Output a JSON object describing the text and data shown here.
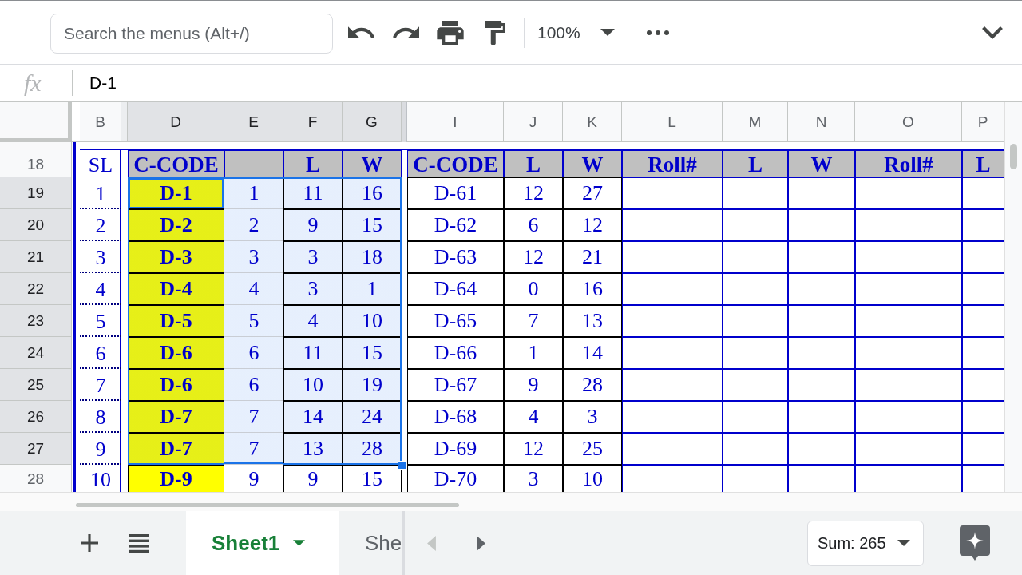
{
  "toolbar": {
    "search": {
      "placeholder": "Search the menus (Alt+/)"
    },
    "zoom": "100%"
  },
  "formula_bar": {
    "label": "fx",
    "value": "D-1"
  },
  "columns": [
    {
      "label": "B",
      "selected": false
    },
    {
      "label": "D",
      "selected": true
    },
    {
      "label": "E",
      "selected": true
    },
    {
      "label": "F",
      "selected": true
    },
    {
      "label": "G",
      "selected": true
    },
    {
      "label": "I",
      "selected": false
    },
    {
      "label": "J",
      "selected": false
    },
    {
      "label": "K",
      "selected": false
    },
    {
      "label": "L",
      "selected": false
    },
    {
      "label": "M",
      "selected": false
    },
    {
      "label": "N",
      "selected": false
    },
    {
      "label": "O",
      "selected": false
    },
    {
      "label": "P",
      "selected": false
    }
  ],
  "rows": [
    {
      "number": "18",
      "selected": false,
      "cells": [
        {
          "text": "SL",
          "kind": "serial",
          "selected": false,
          "active": false
        },
        {
          "text": "C-CODE",
          "kind": "header",
          "selected": false,
          "active": false
        },
        {
          "kind": "header",
          "selected": false,
          "active": false
        },
        {
          "text": "L",
          "kind": "header",
          "selected": false,
          "active": false
        },
        {
          "text": "W",
          "kind": "header",
          "selected": false,
          "active": false
        },
        {
          "text": "C-CODE",
          "kind": "header",
          "selected": false,
          "active": false
        },
        {
          "text": "L",
          "kind": "header",
          "selected": false,
          "active": false
        },
        {
          "text": "W",
          "kind": "header",
          "selected": false,
          "active": false
        },
        {
          "text": "Roll#",
          "kind": "header",
          "selected": false,
          "active": false
        },
        {
          "text": "L",
          "kind": "header",
          "selected": false,
          "active": false
        },
        {
          "text": "W",
          "kind": "header",
          "selected": false,
          "active": false
        },
        {
          "text": "Roll#",
          "kind": "header",
          "selected": false,
          "active": false
        },
        {
          "text": "L",
          "kind": "header",
          "selected": false,
          "active": false
        }
      ]
    },
    {
      "number": "19",
      "selected": true,
      "cells": [
        {
          "text": "1",
          "kind": "serial",
          "selected": false,
          "active": false
        },
        {
          "text": "D-1",
          "kind": "code",
          "selected": true,
          "active": true
        },
        {
          "text": "1",
          "kind": "bare",
          "selected": true,
          "active": false
        },
        {
          "text": "11",
          "kind": "plain",
          "selected": true,
          "active": false
        },
        {
          "text": "16",
          "kind": "plain",
          "selected": true,
          "active": false
        },
        {
          "text": "D-61",
          "kind": "plain",
          "selected": false,
          "active": false
        },
        {
          "text": "12",
          "kind": "plain",
          "selected": false,
          "active": false
        },
        {
          "text": "27",
          "kind": "plain",
          "selected": false,
          "active": false
        }
      ]
    },
    {
      "number": "20",
      "selected": true,
      "cells": [
        {
          "text": "2",
          "kind": "serial",
          "selected": false,
          "active": false
        },
        {
          "text": "D-2",
          "kind": "code",
          "selected": true,
          "active": false
        },
        {
          "text": "2",
          "kind": "bare",
          "selected": true,
          "active": false
        },
        {
          "text": "9",
          "kind": "plain",
          "selected": true,
          "active": false
        },
        {
          "text": "15",
          "kind": "plain",
          "selected": true,
          "active": false
        },
        {
          "text": "D-62",
          "kind": "plain",
          "selected": false,
          "active": false
        },
        {
          "text": "6",
          "kind": "plain",
          "selected": false,
          "active": false
        },
        {
          "text": "12",
          "kind": "plain",
          "selected": false,
          "active": false
        }
      ]
    },
    {
      "number": "21",
      "selected": true,
      "cells": [
        {
          "text": "3",
          "kind": "serial",
          "selected": false,
          "active": false
        },
        {
          "text": "D-3",
          "kind": "code",
          "selected": true,
          "active": false
        },
        {
          "text": "3",
          "kind": "bare",
          "selected": true,
          "active": false
        },
        {
          "text": "3",
          "kind": "plain",
          "selected": true,
          "active": false
        },
        {
          "text": "18",
          "kind": "plain",
          "selected": true,
          "active": false
        },
        {
          "text": "D-63",
          "kind": "plain",
          "selected": false,
          "active": false
        },
        {
          "text": "12",
          "kind": "plain",
          "selected": false,
          "active": false
        },
        {
          "text": "21",
          "kind": "plain",
          "selected": false,
          "active": false
        }
      ]
    },
    {
      "number": "22",
      "selected": true,
      "cells": [
        {
          "text": "4",
          "kind": "serial",
          "selected": false,
          "active": false
        },
        {
          "text": "D-4",
          "kind": "code",
          "selected": true,
          "active": false
        },
        {
          "text": "4",
          "kind": "bare",
          "selected": true,
          "active": false
        },
        {
          "text": "3",
          "kind": "plain",
          "selected": true,
          "active": false
        },
        {
          "text": "1",
          "kind": "plain",
          "selected": true,
          "active": false
        },
        {
          "text": "D-64",
          "kind": "plain",
          "selected": false,
          "active": false
        },
        {
          "text": "0",
          "kind": "plain",
          "selected": false,
          "active": false
        },
        {
          "text": "16",
          "kind": "plain",
          "selected": false,
          "active": false
        }
      ]
    },
    {
      "number": "23",
      "selected": true,
      "cells": [
        {
          "text": "5",
          "kind": "serial",
          "selected": false,
          "active": false
        },
        {
          "text": "D-5",
          "kind": "code",
          "selected": true,
          "active": false
        },
        {
          "text": "5",
          "kind": "bare",
          "selected": true,
          "active": false
        },
        {
          "text": "4",
          "kind": "plain",
          "selected": true,
          "active": false
        },
        {
          "text": "10",
          "kind": "plain",
          "selected": true,
          "active": false
        },
        {
          "text": "D-65",
          "kind": "plain",
          "selected": false,
          "active": false
        },
        {
          "text": "7",
          "kind": "plain",
          "selected": false,
          "active": false
        },
        {
          "text": "13",
          "kind": "plain",
          "selected": false,
          "active": false
        }
      ]
    },
    {
      "number": "24",
      "selected": true,
      "cells": [
        {
          "text": "6",
          "kind": "serial",
          "selected": false,
          "active": false
        },
        {
          "text": "D-6",
          "kind": "code",
          "selected": true,
          "active": false
        },
        {
          "text": "6",
          "kind": "bare",
          "selected": true,
          "active": false
        },
        {
          "text": "11",
          "kind": "plain",
          "selected": true,
          "active": false
        },
        {
          "text": "15",
          "kind": "plain",
          "selected": true,
          "active": false
        },
        {
          "text": "D-66",
          "kind": "plain",
          "selected": false,
          "active": false
        },
        {
          "text": "1",
          "kind": "plain",
          "selected": false,
          "active": false
        },
        {
          "text": "14",
          "kind": "plain",
          "selected": false,
          "active": false
        }
      ]
    },
    {
      "number": "25",
      "selected": true,
      "cells": [
        {
          "text": "7",
          "kind": "serial",
          "selected": false,
          "active": false
        },
        {
          "text": "D-6",
          "kind": "code",
          "selected": true,
          "active": false
        },
        {
          "text": "6",
          "kind": "bare",
          "selected": true,
          "active": false
        },
        {
          "text": "10",
          "kind": "plain",
          "selected": true,
          "active": false
        },
        {
          "text": "19",
          "kind": "plain",
          "selected": true,
          "active": false
        },
        {
          "text": "D-67",
          "kind": "plain",
          "selected": false,
          "active": false
        },
        {
          "text": "9",
          "kind": "plain",
          "selected": false,
          "active": false
        },
        {
          "text": "28",
          "kind": "plain",
          "selected": false,
          "active": false
        }
      ]
    },
    {
      "number": "26",
      "selected": true,
      "cells": [
        {
          "text": "8",
          "kind": "serial",
          "selected": false,
          "active": false
        },
        {
          "text": "D-7",
          "kind": "code",
          "selected": true,
          "active": false
        },
        {
          "text": "7",
          "kind": "bare",
          "selected": true,
          "active": false
        },
        {
          "text": "14",
          "kind": "plain",
          "selected": true,
          "active": false
        },
        {
          "text": "24",
          "kind": "plain",
          "selected": true,
          "active": false
        },
        {
          "text": "D-68",
          "kind": "plain",
          "selected": false,
          "active": false
        },
        {
          "text": "4",
          "kind": "plain",
          "selected": false,
          "active": false
        },
        {
          "text": "3",
          "kind": "plain",
          "selected": false,
          "active": false
        }
      ]
    },
    {
      "number": "27",
      "selected": true,
      "cells": [
        {
          "text": "9",
          "kind": "serial",
          "selected": false,
          "active": false
        },
        {
          "text": "D-7",
          "kind": "code",
          "selected": true,
          "active": false
        },
        {
          "text": "7",
          "kind": "bare",
          "selected": true,
          "active": false
        },
        {
          "text": "13",
          "kind": "plain",
          "selected": true,
          "active": false
        },
        {
          "text": "28",
          "kind": "plain",
          "selected": true,
          "active": false
        },
        {
          "text": "D-69",
          "kind": "plain",
          "selected": false,
          "active": false
        },
        {
          "text": "12",
          "kind": "plain",
          "selected": false,
          "active": false
        },
        {
          "text": "25",
          "kind": "plain",
          "selected": false,
          "active": false
        }
      ]
    },
    {
      "number": "28",
      "selected": false,
      "cells": [
        {
          "text": "10",
          "kind": "serial",
          "selected": false,
          "active": false
        },
        {
          "text": "D-9",
          "kind": "code",
          "selected": false,
          "active": false
        },
        {
          "text": "9",
          "kind": "bare",
          "selected": false,
          "active": false
        },
        {
          "text": "9",
          "kind": "plain",
          "selected": false,
          "active": false
        },
        {
          "text": "15",
          "kind": "plain",
          "selected": false,
          "active": false
        },
        {
          "text": "D-70",
          "kind": "plain",
          "selected": false,
          "active": false
        },
        {
          "text": "3",
          "kind": "plain",
          "selected": false,
          "active": false
        },
        {
          "text": "10",
          "kind": "plain",
          "selected": false,
          "active": false
        }
      ]
    }
  ],
  "sheet_tabs": [
    {
      "label": "Sheet1",
      "selected": true
    },
    {
      "label": "She",
      "selected": false
    }
  ],
  "tab_scroll": [
    {
      "kind": "left",
      "disabled": true
    },
    {
      "kind": "right",
      "disabled": false
    }
  ],
  "status": {
    "sum": "Sum: 265"
  }
}
